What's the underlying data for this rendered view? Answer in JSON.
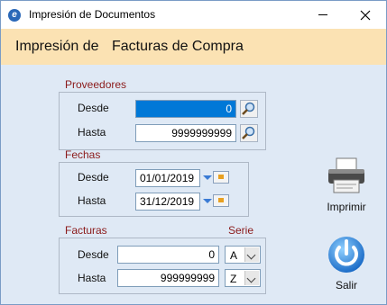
{
  "window": {
    "title": "Impresión de Documentos"
  },
  "header": {
    "prefix": "Impresión de",
    "document_type": "Facturas de Compra"
  },
  "proveedores": {
    "legend": "Proveedores",
    "desde_label": "Desde",
    "desde_value": "0",
    "hasta_label": "Hasta",
    "hasta_value": "9999999999"
  },
  "fechas": {
    "legend": "Fechas",
    "desde_label": "Desde",
    "desde_value": "01/01/2019",
    "hasta_label": "Hasta",
    "hasta_value": "31/12/2019"
  },
  "facturas": {
    "legend": "Facturas",
    "serie_label": "Serie",
    "desde_label": "Desde",
    "desde_value": "0",
    "desde_serie": "A",
    "hasta_label": "Hasta",
    "hasta_value": "999999999",
    "hasta_serie": "Z"
  },
  "actions": {
    "print_label": "Imprimir",
    "exit_label": "Salir"
  },
  "colors": {
    "header_bg": "#fbe2b3",
    "legend_text": "#8b1a1a",
    "selection": "#0078d7"
  }
}
